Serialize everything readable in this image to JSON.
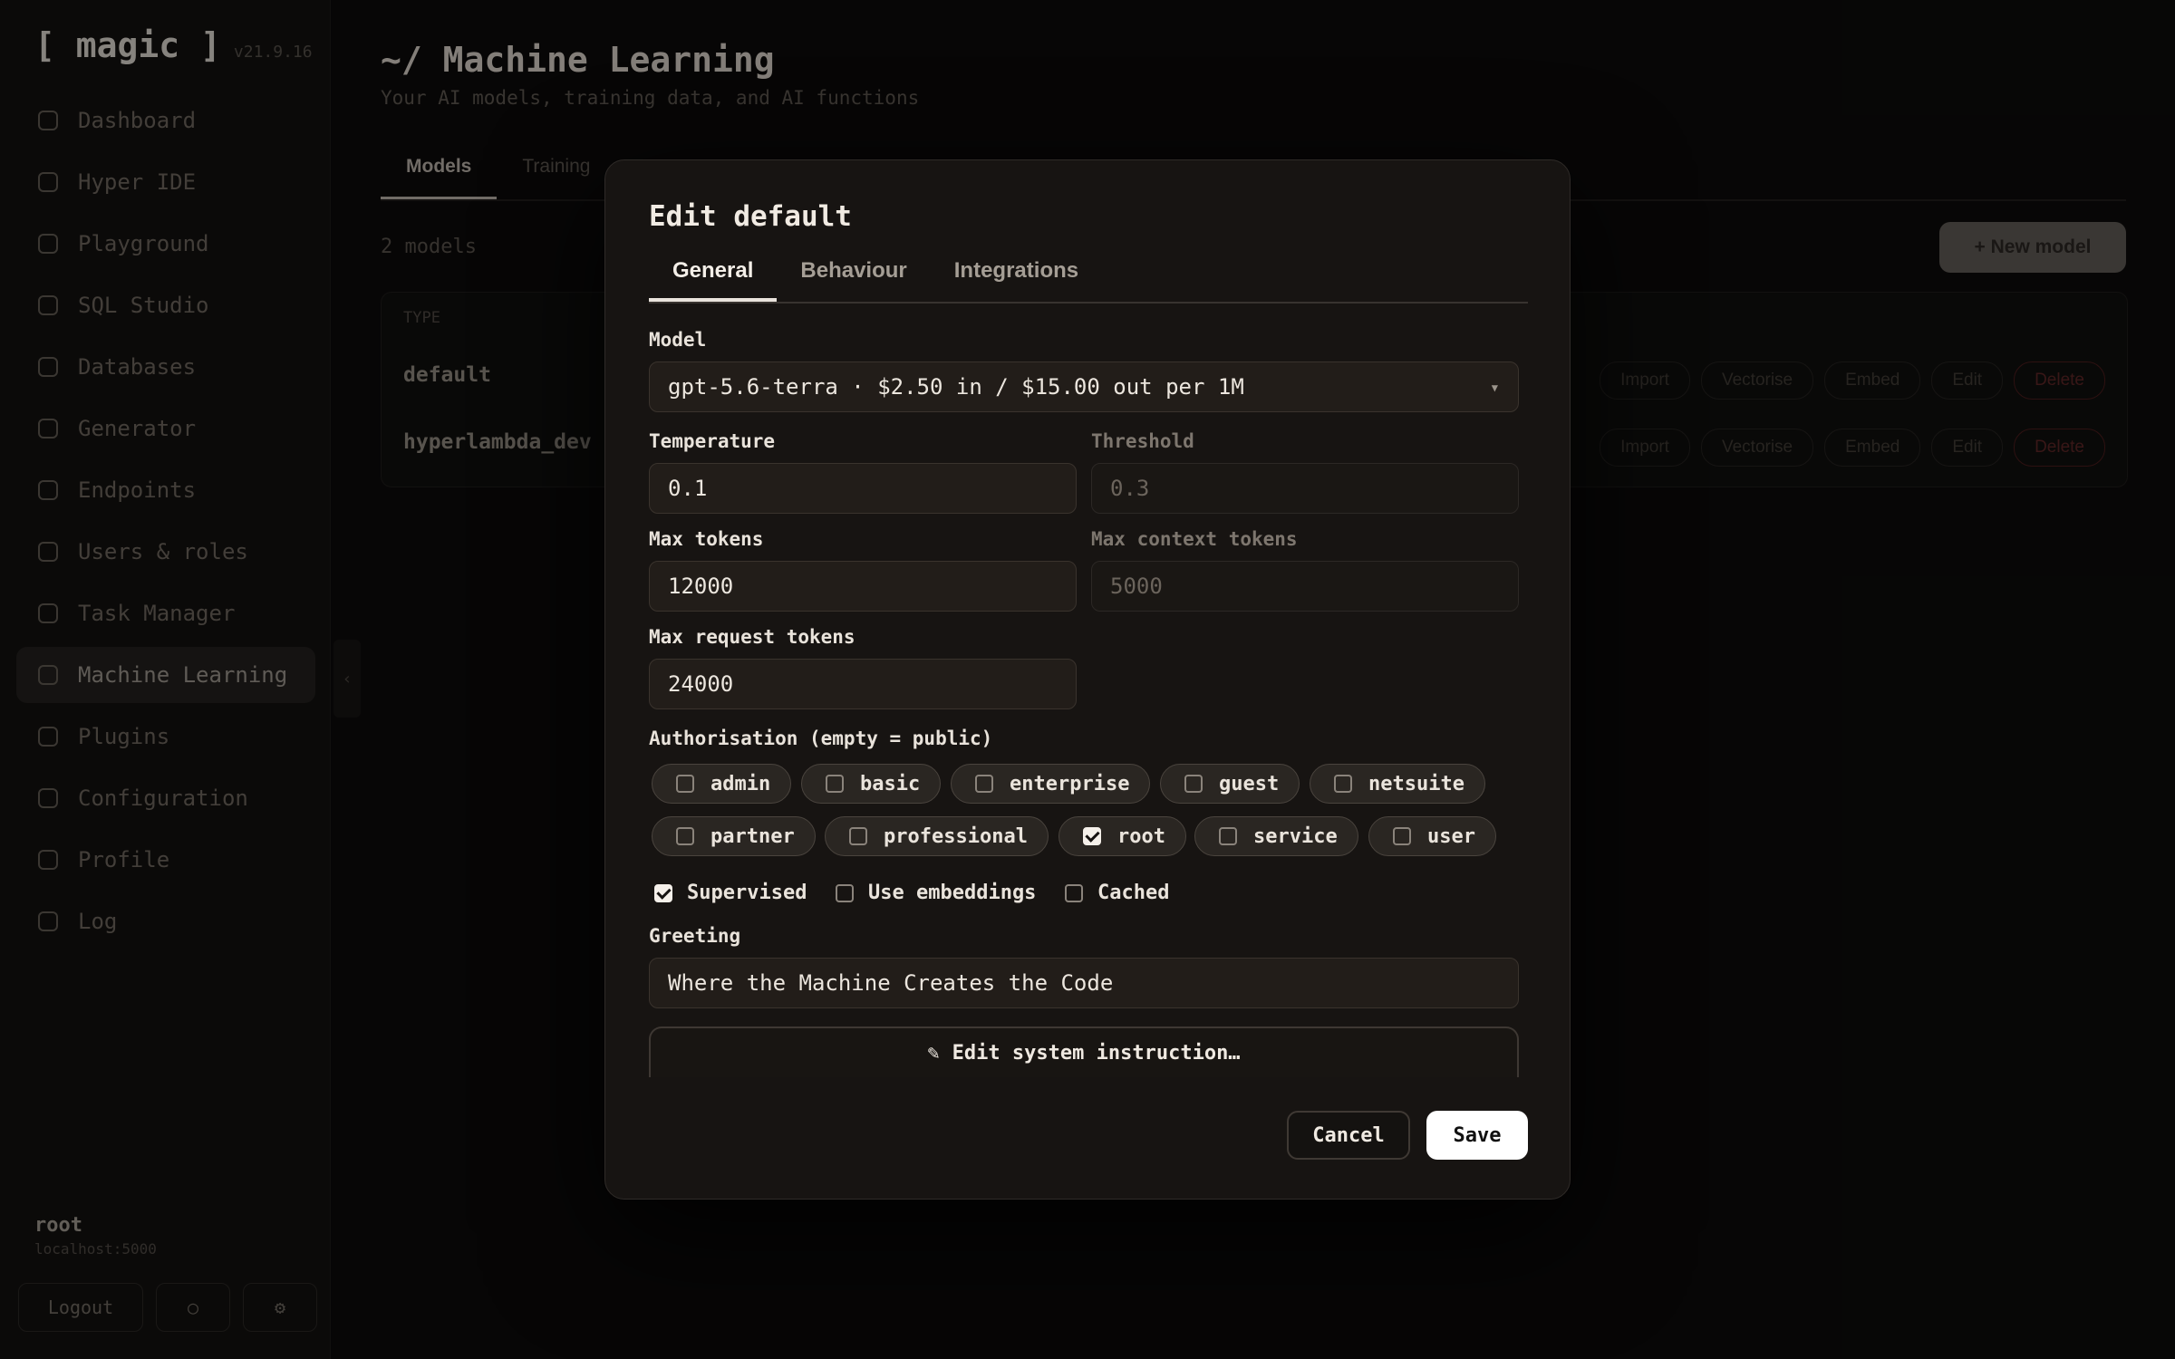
{
  "app": {
    "brand": "[ magic ]",
    "version": "v21.9.16",
    "nav": [
      {
        "label": "Dashboard",
        "icon": "home-icon"
      },
      {
        "label": "Hyper IDE",
        "icon": "file-icon"
      },
      {
        "label": "Playground",
        "icon": "play-icon"
      },
      {
        "label": "SQL Studio",
        "icon": "terminal-icon"
      },
      {
        "label": "Databases",
        "icon": "database-icon"
      },
      {
        "label": "Generator",
        "icon": "sparkle-icon"
      },
      {
        "label": "Endpoints",
        "icon": "endpoints-icon"
      },
      {
        "label": "Users & roles",
        "icon": "user-icon"
      },
      {
        "label": "Task Manager",
        "icon": "clock-icon"
      },
      {
        "label": "Machine Learning",
        "icon": "brain-icon",
        "active": true
      },
      {
        "label": "Plugins",
        "icon": "plugin-icon"
      },
      {
        "label": "Configuration",
        "icon": "config-icon"
      },
      {
        "label": "Profile",
        "icon": "profile-icon"
      },
      {
        "label": "Log",
        "icon": "log-icon"
      }
    ],
    "user": {
      "name": "root",
      "host": "localhost:5000"
    },
    "logout_label": "Logout",
    "page_title": "~/ Machine Learning",
    "page_subtitle": "Your AI models, training data, and AI functions",
    "tabs": [
      "Models",
      "Training"
    ],
    "model_count": "2 models",
    "new_model_label": "+ New model",
    "table_header": "TYPE",
    "rows": [
      "default",
      "hyperlambda_dev"
    ],
    "row_actions": [
      "Import",
      "Vectorise",
      "Embed",
      "Edit",
      "Delete"
    ]
  },
  "modal": {
    "title": "Edit default",
    "tabs": [
      "General",
      "Behaviour",
      "Integrations"
    ],
    "active_tab": "General",
    "model": {
      "label": "Model",
      "value": "gpt-5.6-terra · $2.50 in / $15.00 out per 1M"
    },
    "temperature": {
      "label": "Temperature",
      "value": "0.1"
    },
    "threshold": {
      "label": "Threshold",
      "placeholder": "0.3"
    },
    "max_tokens": {
      "label": "Max tokens",
      "value": "12000"
    },
    "max_context_tokens": {
      "label": "Max context tokens",
      "placeholder": "5000"
    },
    "max_request_tokens": {
      "label": "Max request tokens",
      "value": "24000"
    },
    "authorisation": {
      "label": "Authorisation (empty = public)",
      "roles": [
        {
          "name": "admin",
          "checked": false
        },
        {
          "name": "basic",
          "checked": false
        },
        {
          "name": "enterprise",
          "checked": false
        },
        {
          "name": "guest",
          "checked": false
        },
        {
          "name": "netsuite",
          "checked": false
        },
        {
          "name": "partner",
          "checked": false
        },
        {
          "name": "professional",
          "checked": false
        },
        {
          "name": "root",
          "checked": true
        },
        {
          "name": "service",
          "checked": false
        },
        {
          "name": "user",
          "checked": false
        }
      ]
    },
    "flags": [
      {
        "label": "Supervised",
        "checked": true
      },
      {
        "label": "Use embeddings",
        "checked": false
      },
      {
        "label": "Cached",
        "checked": false
      }
    ],
    "greeting": {
      "label": "Greeting",
      "value": "Where the Machine Creates the Code"
    },
    "system_instruction_label": "Edit system instruction…",
    "cancel_label": "Cancel",
    "save_label": "Save"
  }
}
